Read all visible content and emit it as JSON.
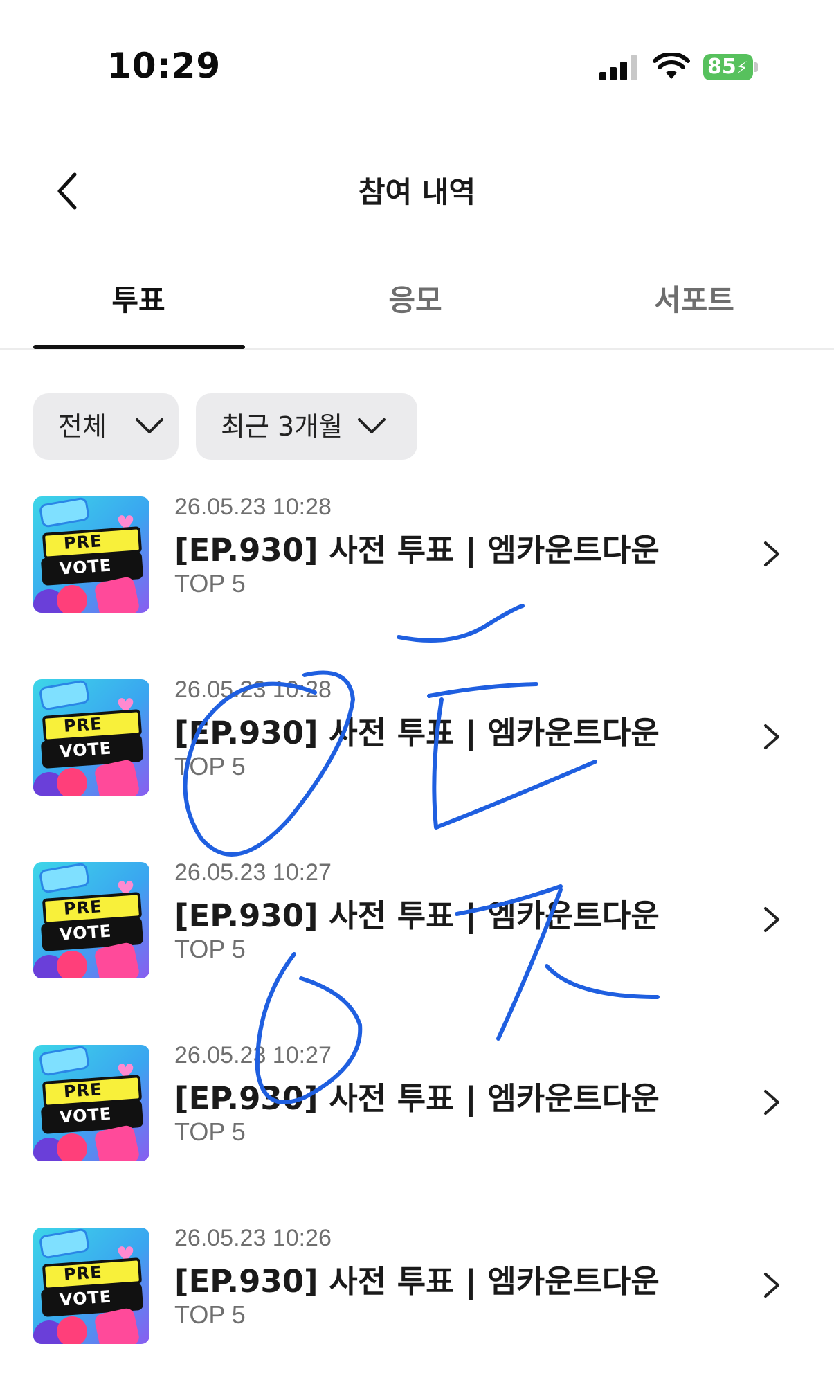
{
  "status_bar": {
    "time": "10:29",
    "battery": "85",
    "icons": [
      "signal-icon",
      "wifi-icon",
      "battery-charging-icon"
    ]
  },
  "header": {
    "title": "참여 내역",
    "back_icon": "chevron-left-icon"
  },
  "tabs": [
    {
      "label": "투표",
      "active": true
    },
    {
      "label": "응모",
      "active": false
    },
    {
      "label": "서포트",
      "active": false
    }
  ],
  "filters": [
    {
      "label": "전체",
      "icon": "chevron-down-icon"
    },
    {
      "label": "최근 3개월",
      "icon": "chevron-down-icon"
    }
  ],
  "items": [
    {
      "date": "26.05.23 10:28",
      "title": "[EP.930] 사전 투표 | 엠카운트다운",
      "subtitle": "TOP 5",
      "thumb_text": [
        "PRE",
        "VOTE"
      ]
    },
    {
      "date": "26.05.23 10:28",
      "title": "[EP.930] 사전 투표 | 엠카운트다운",
      "subtitle": "TOP 5",
      "thumb_text": [
        "PRE",
        "VOTE"
      ]
    },
    {
      "date": "26.05.23 10:27",
      "title": "[EP.930] 사전 투표 | 엠카운트다운",
      "subtitle": "TOP 5",
      "thumb_text": [
        "PRE",
        "VOTE"
      ]
    },
    {
      "date": "26.05.23 10:27",
      "title": "[EP.930] 사전 투표 | 엠카운트다운",
      "subtitle": "TOP 5",
      "thumb_text": [
        "PRE",
        "VOTE"
      ]
    },
    {
      "date": "26.05.23 10:26",
      "title": "[EP.930] 사전 투표 | 엠카운트다운",
      "subtitle": "TOP 5",
      "thumb_text": [
        "PRE",
        "VOTE"
      ]
    }
  ],
  "colors": {
    "accent": "#111111",
    "scribble": "#1f5fe0",
    "battery": "#57c15d",
    "filter_bg": "#ebebed",
    "muted_text": "#6f6f6f"
  }
}
